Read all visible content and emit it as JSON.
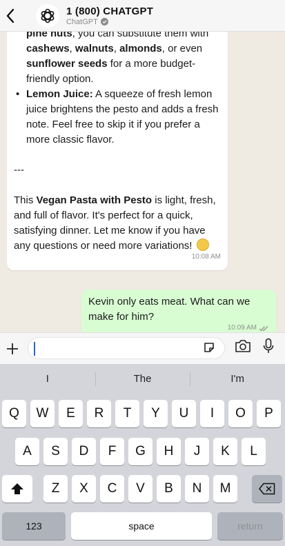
{
  "header": {
    "title": "1 (800) CHATGPT",
    "subtitle": "ChatGPT"
  },
  "messages": {
    "incoming": {
      "line1_bold": "pine nuts",
      "line1_rest": ", you can substitute them with ",
      "nut1": "cashews",
      "sep1": ", ",
      "nut2": "walnuts",
      "sep2": ", ",
      "nut3": "almonds",
      "sep3": ", or even ",
      "nut4": "sunflower seeds",
      "line1_end": " for a more budget-friendly option.",
      "bullet": "•",
      "lemon_bold": "Lemon Juice:",
      "lemon_text": " A squeeze of fresh lemon juice brightens the pesto and adds a fresh note. Feel free to skip it if you prefer a more classic flavor.",
      "divider": "---",
      "closing_pre": "This ",
      "closing_bold": "Vegan Pasta with Pesto",
      "closing_post": " is light, fresh, and full of flavor. It's perfect for a quick, satisfying dinner. Let me know if you have any questions or need more variations!",
      "time": "10:08 AM"
    },
    "outgoing": {
      "text": "Kevin only eats meat. What can we make for him?",
      "time": "10:09 AM"
    }
  },
  "input": {
    "value": ""
  },
  "keyboard": {
    "suggestions": [
      "I",
      "The",
      "I'm"
    ],
    "row1": [
      "Q",
      "W",
      "E",
      "R",
      "T",
      "Y",
      "U",
      "I",
      "O",
      "P"
    ],
    "row2": [
      "A",
      "S",
      "D",
      "F",
      "G",
      "H",
      "J",
      "K",
      "L"
    ],
    "row3": [
      "Z",
      "X",
      "C",
      "V",
      "B",
      "N",
      "M"
    ],
    "numbers_label": "123",
    "space_label": "space",
    "return_label": "return"
  },
  "icons": {
    "back": "chevron-left-icon",
    "avatar": "openai-logo-icon",
    "verified": "verified-badge-icon",
    "plus": "plus-icon",
    "sticker": "sticker-icon",
    "camera": "camera-icon",
    "mic": "microphone-icon",
    "shift": "shift-icon",
    "delete": "backspace-icon",
    "read": "double-check-icon"
  },
  "colors": {
    "outgoing_bubble": "#d9fdd3",
    "chat_background": "#efeae2",
    "keyboard_background": "#d3d5db"
  }
}
